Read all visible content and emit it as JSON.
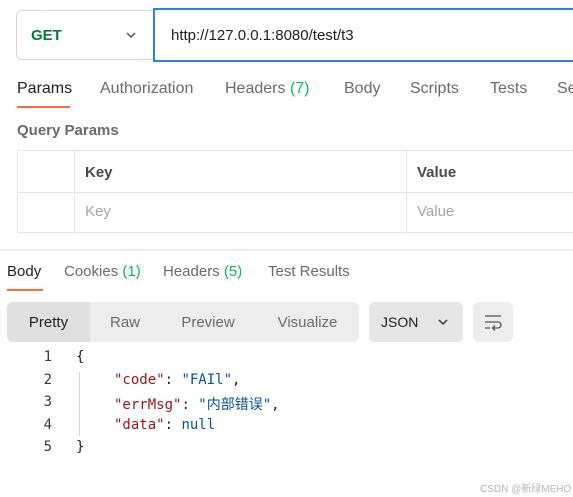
{
  "request": {
    "method": "GET",
    "url": "http://127.0.0.1:8080/test/t3"
  },
  "request_tabs": [
    {
      "label": "Params",
      "count": ""
    },
    {
      "label": "Authorization",
      "count": ""
    },
    {
      "label": "Headers",
      "count": "(7)"
    },
    {
      "label": "Body",
      "count": ""
    },
    {
      "label": "Scripts",
      "count": ""
    },
    {
      "label": "Tests",
      "count": ""
    },
    {
      "label": "Se",
      "count": ""
    }
  ],
  "query_params": {
    "title": "Query Params",
    "headers": [
      "Key",
      "Value"
    ],
    "placeholders": [
      "Key",
      "Value"
    ]
  },
  "response_tabs": [
    {
      "label": "Body",
      "count": ""
    },
    {
      "label": "Cookies",
      "count": "(1)"
    },
    {
      "label": "Headers",
      "count": "(5)"
    },
    {
      "label": "Test Results",
      "count": ""
    }
  ],
  "view_modes": [
    "Pretty",
    "Raw",
    "Preview",
    "Visualize"
  ],
  "format": "JSON",
  "response_body": {
    "line_numbers": [
      "1",
      "2",
      "3",
      "4",
      "5"
    ],
    "open_brace": "{",
    "close_brace": "}",
    "code_key": "\"code\"",
    "code_value": "\"FAIl\"",
    "errmsg_key": "\"errMsg\"",
    "errmsg_value": "\"内部错误\"",
    "data_key": "\"data\"",
    "data_value": "null"
  },
  "watermark": "CSDN @新绿MEHO",
  "colors": {
    "method_get": "#007f31",
    "accent": "#ff6c37",
    "count": "#0cbb52",
    "url_border": "#2f80ed"
  }
}
